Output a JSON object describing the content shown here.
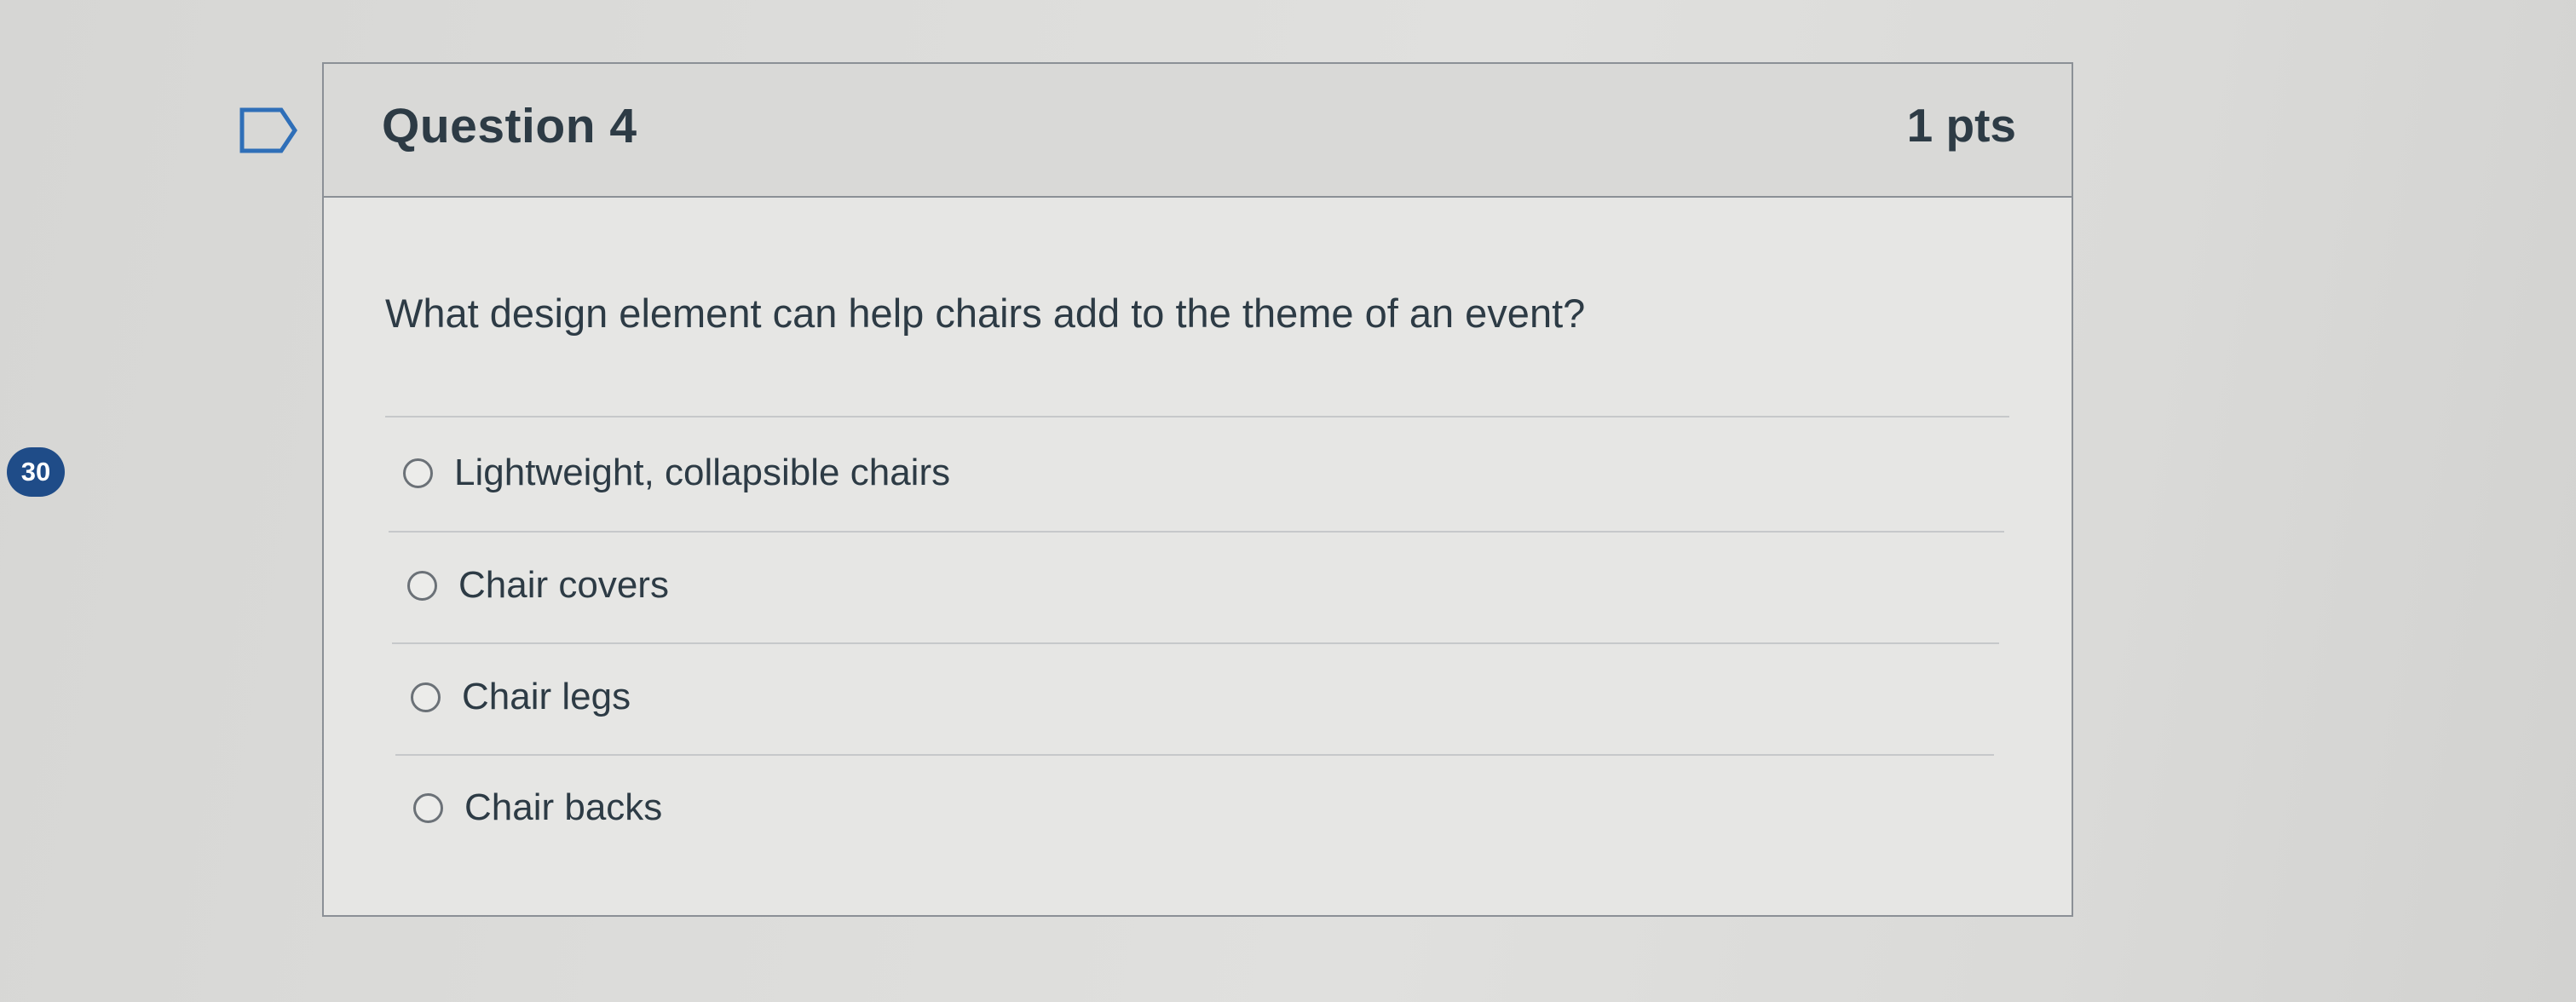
{
  "sidebar": {
    "badge_count": "30"
  },
  "question": {
    "title": "Question 4",
    "points": "1 pts",
    "text": "What design element can help chairs add to the theme of an event?",
    "answers": [
      {
        "label": "Lightweight, collapsible chairs",
        "selected": false
      },
      {
        "label": "Chair covers",
        "selected": false
      },
      {
        "label": "Chair legs",
        "selected": false
      },
      {
        "label": "Chair backs",
        "selected": false
      }
    ]
  },
  "icons": {
    "flag": "flag-question-icon",
    "radio": "radio-unselected-icon"
  },
  "colors": {
    "badge_bg": "#1f4c88",
    "text": "#2d3b45",
    "border": "#8b9096",
    "header_bg": "#d9d9d7",
    "card_bg": "#e6e6e4"
  }
}
